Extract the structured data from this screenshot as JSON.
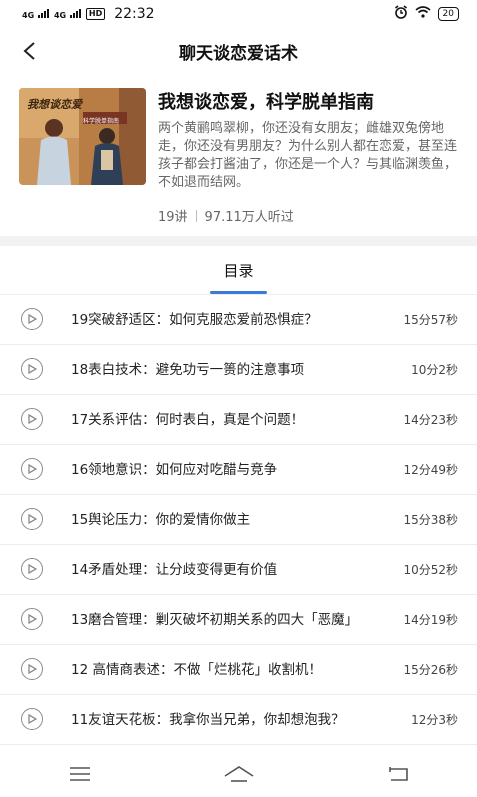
{
  "status": {
    "signal1": "4G",
    "signal2": "4G",
    "hd": "HD",
    "time": "22:32",
    "battery": "20"
  },
  "nav": {
    "title": "聊天谈恋爱话术"
  },
  "course": {
    "cover_label": "我想谈恋爱",
    "cover_sub": "科学脱单指南",
    "title": "我想谈恋爱，科学脱单指南",
    "description": "两个黄鹂鸣翠柳，你还没有女朋友；雌雄双兔傍地走，你还没有男朋友？为什么别人都在恋爱，甚至连孩子都会打酱油了，你还是一个人？与其临渊羡鱼，不如退而结网。",
    "lectures": "19讲",
    "listeners": "97.11万人听过"
  },
  "tab": {
    "label": "目录"
  },
  "episodes": [
    {
      "title": "19突破舒适区：如何克服恋爱前恐惧症？",
      "duration": "15分57秒"
    },
    {
      "title": "18表白技术：避免功亏一篑的注意事项",
      "duration": "10分2秒"
    },
    {
      "title": "17关系评估：何时表白，真是个问题！",
      "duration": "14分23秒"
    },
    {
      "title": "16领地意识：如何应对吃醋与竞争",
      "duration": "12分49秒"
    },
    {
      "title": "15舆论压力：你的爱情你做主",
      "duration": "15分38秒"
    },
    {
      "title": "14矛盾处理：让分歧变得更有价值",
      "duration": "10分52秒"
    },
    {
      "title": "13磨合管理：剿灭破坏初期关系的四大「恶魔」",
      "duration": "14分19秒"
    },
    {
      "title": "12 高情商表述：不做「烂桃花」收割机！",
      "duration": "15分26秒"
    },
    {
      "title": "11友谊天花板：我拿你当兄弟，你却想泡我？",
      "duration": "12分3秒"
    }
  ],
  "colors": {
    "accent": "#3a7bd5",
    "text": "#222222",
    "muted": "#666666"
  }
}
